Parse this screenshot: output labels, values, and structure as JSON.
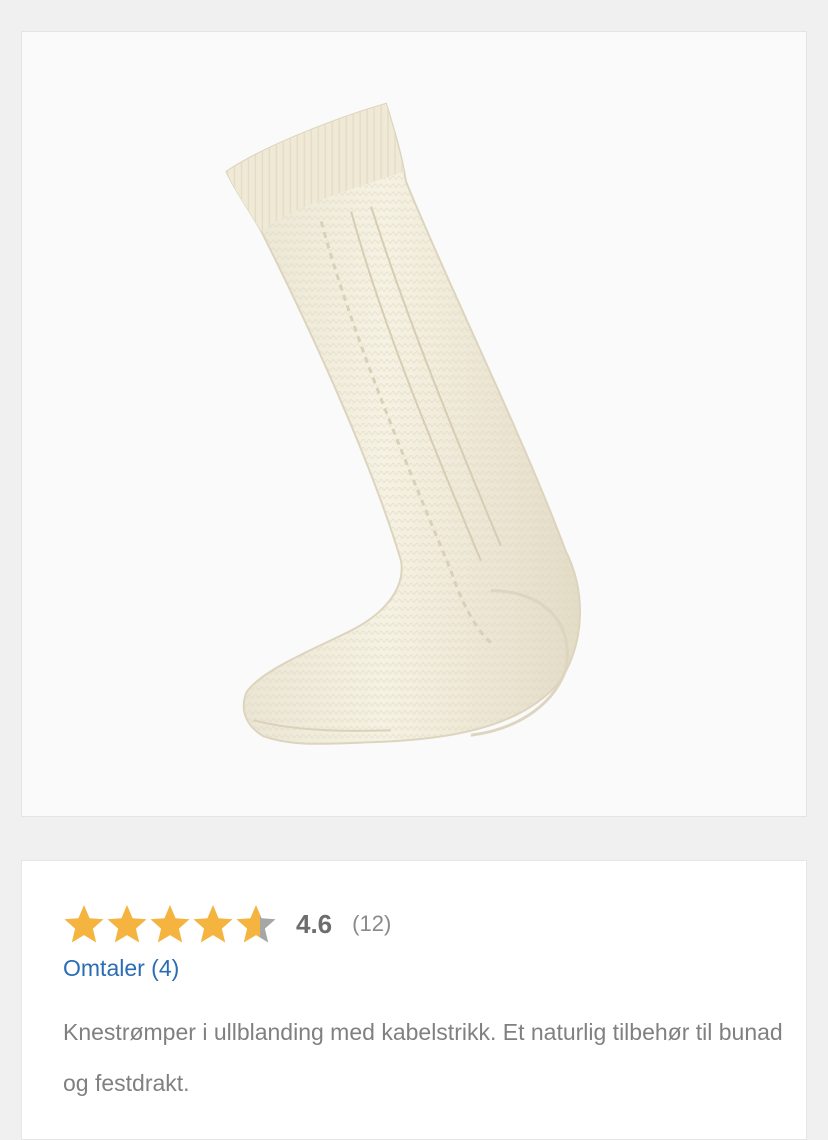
{
  "product": {
    "image_alt": "Knestrømper",
    "rating": {
      "value": "4.6",
      "count": "(12)",
      "score": 4.6,
      "max": 5,
      "star_color": "#f4b43f",
      "star_empty_color": "#a6a6a6"
    },
    "reviews_link": "Omtaler (4)",
    "description": "Knestrømper i ullblanding med kabelstrikk. Et naturlig tilbehør til bunad og festdrakt."
  },
  "icons": {
    "star": "star-icon"
  },
  "colors": {
    "link": "#2a6db3",
    "background": "#f0f0f0"
  }
}
